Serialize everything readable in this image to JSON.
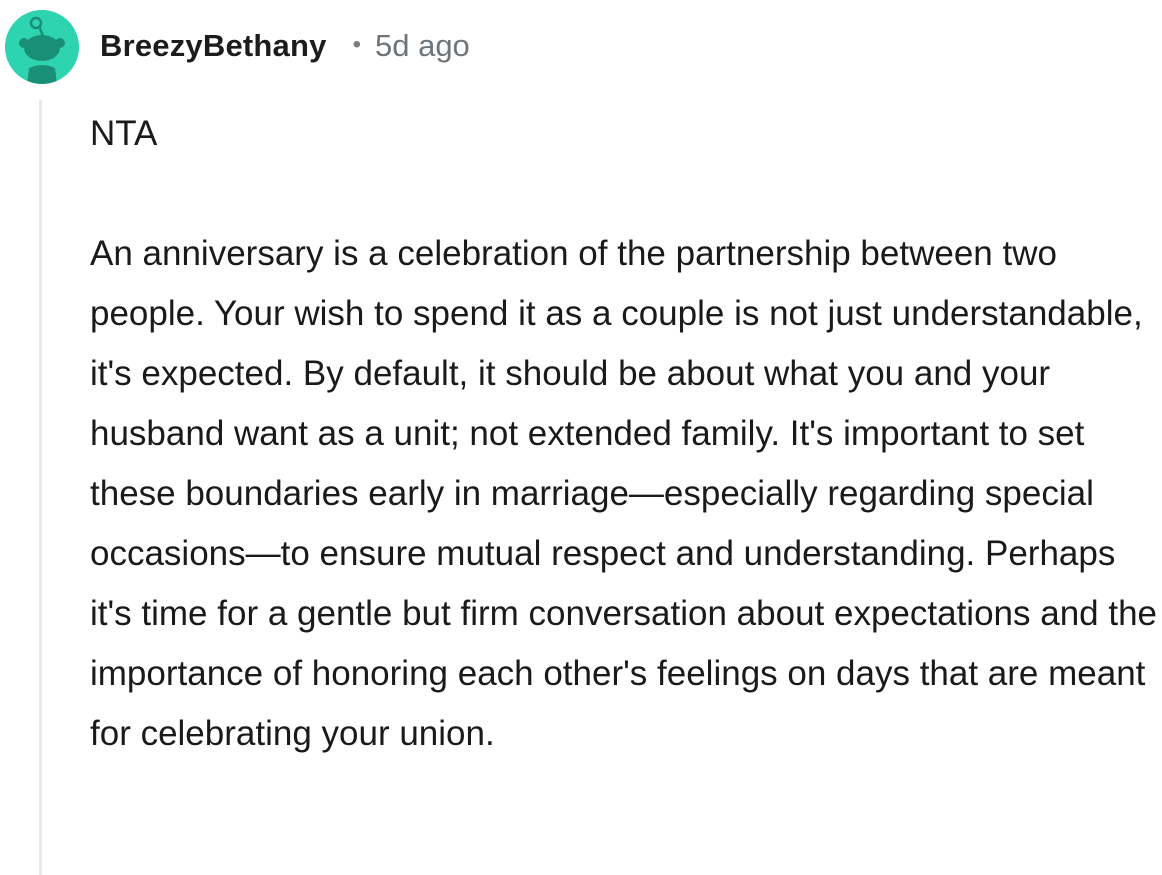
{
  "comment": {
    "author": "BreezyBethany",
    "separator": "•",
    "timestamp": "5d ago",
    "avatar_icon": "reddit-snoo-avatar-icon",
    "avatar_color": "#2ed3b0",
    "paragraphs": [
      "NTA",
      "An anniversary is a celebration of the partnership between two people. Your wish to spend it as a couple is not just understandable, it's expected. By default, it should be about what you and your husband want as a unit; not extended family. It's important to set these boundaries early in marriage—especially regarding special occasions—to ensure mutual respect and understanding. Perhaps it's time for a gentle but firm conversation about expectations and the importance of honoring each other's feelings on days that are meant for celebrating your union."
    ]
  }
}
